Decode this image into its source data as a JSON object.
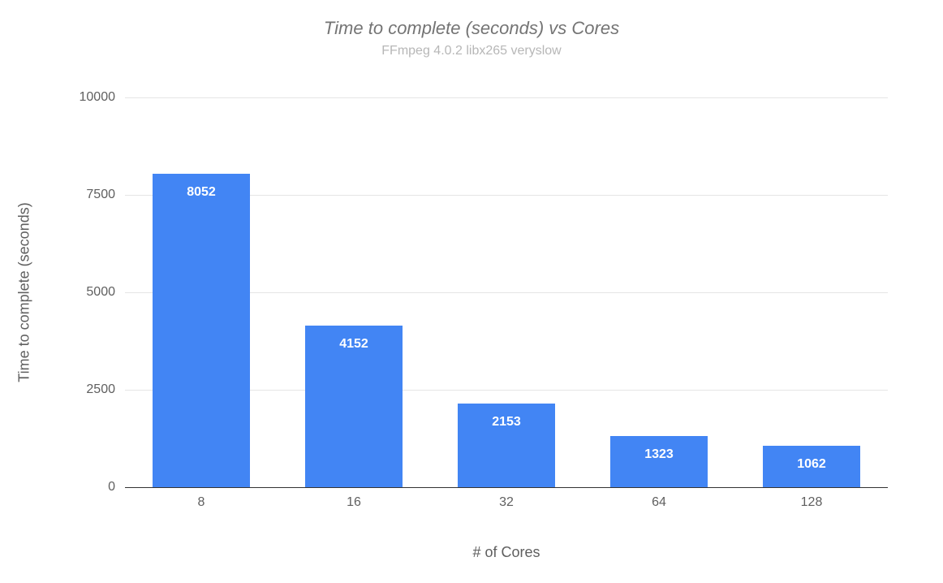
{
  "chart_data": {
    "type": "bar",
    "title": "Time to complete (seconds) vs Cores",
    "subtitle": "FFmpeg 4.0.2 libx265 veryslow",
    "xlabel": "# of Cores",
    "ylabel": "Time to complete (seconds)",
    "categories": [
      "8",
      "16",
      "32",
      "64",
      "128"
    ],
    "values": [
      8052,
      4152,
      2153,
      1323,
      1062
    ],
    "ylim": [
      0,
      10000
    ],
    "yticks": [
      0,
      2500,
      5000,
      7500,
      10000
    ],
    "bar_color": "#4285f4"
  }
}
